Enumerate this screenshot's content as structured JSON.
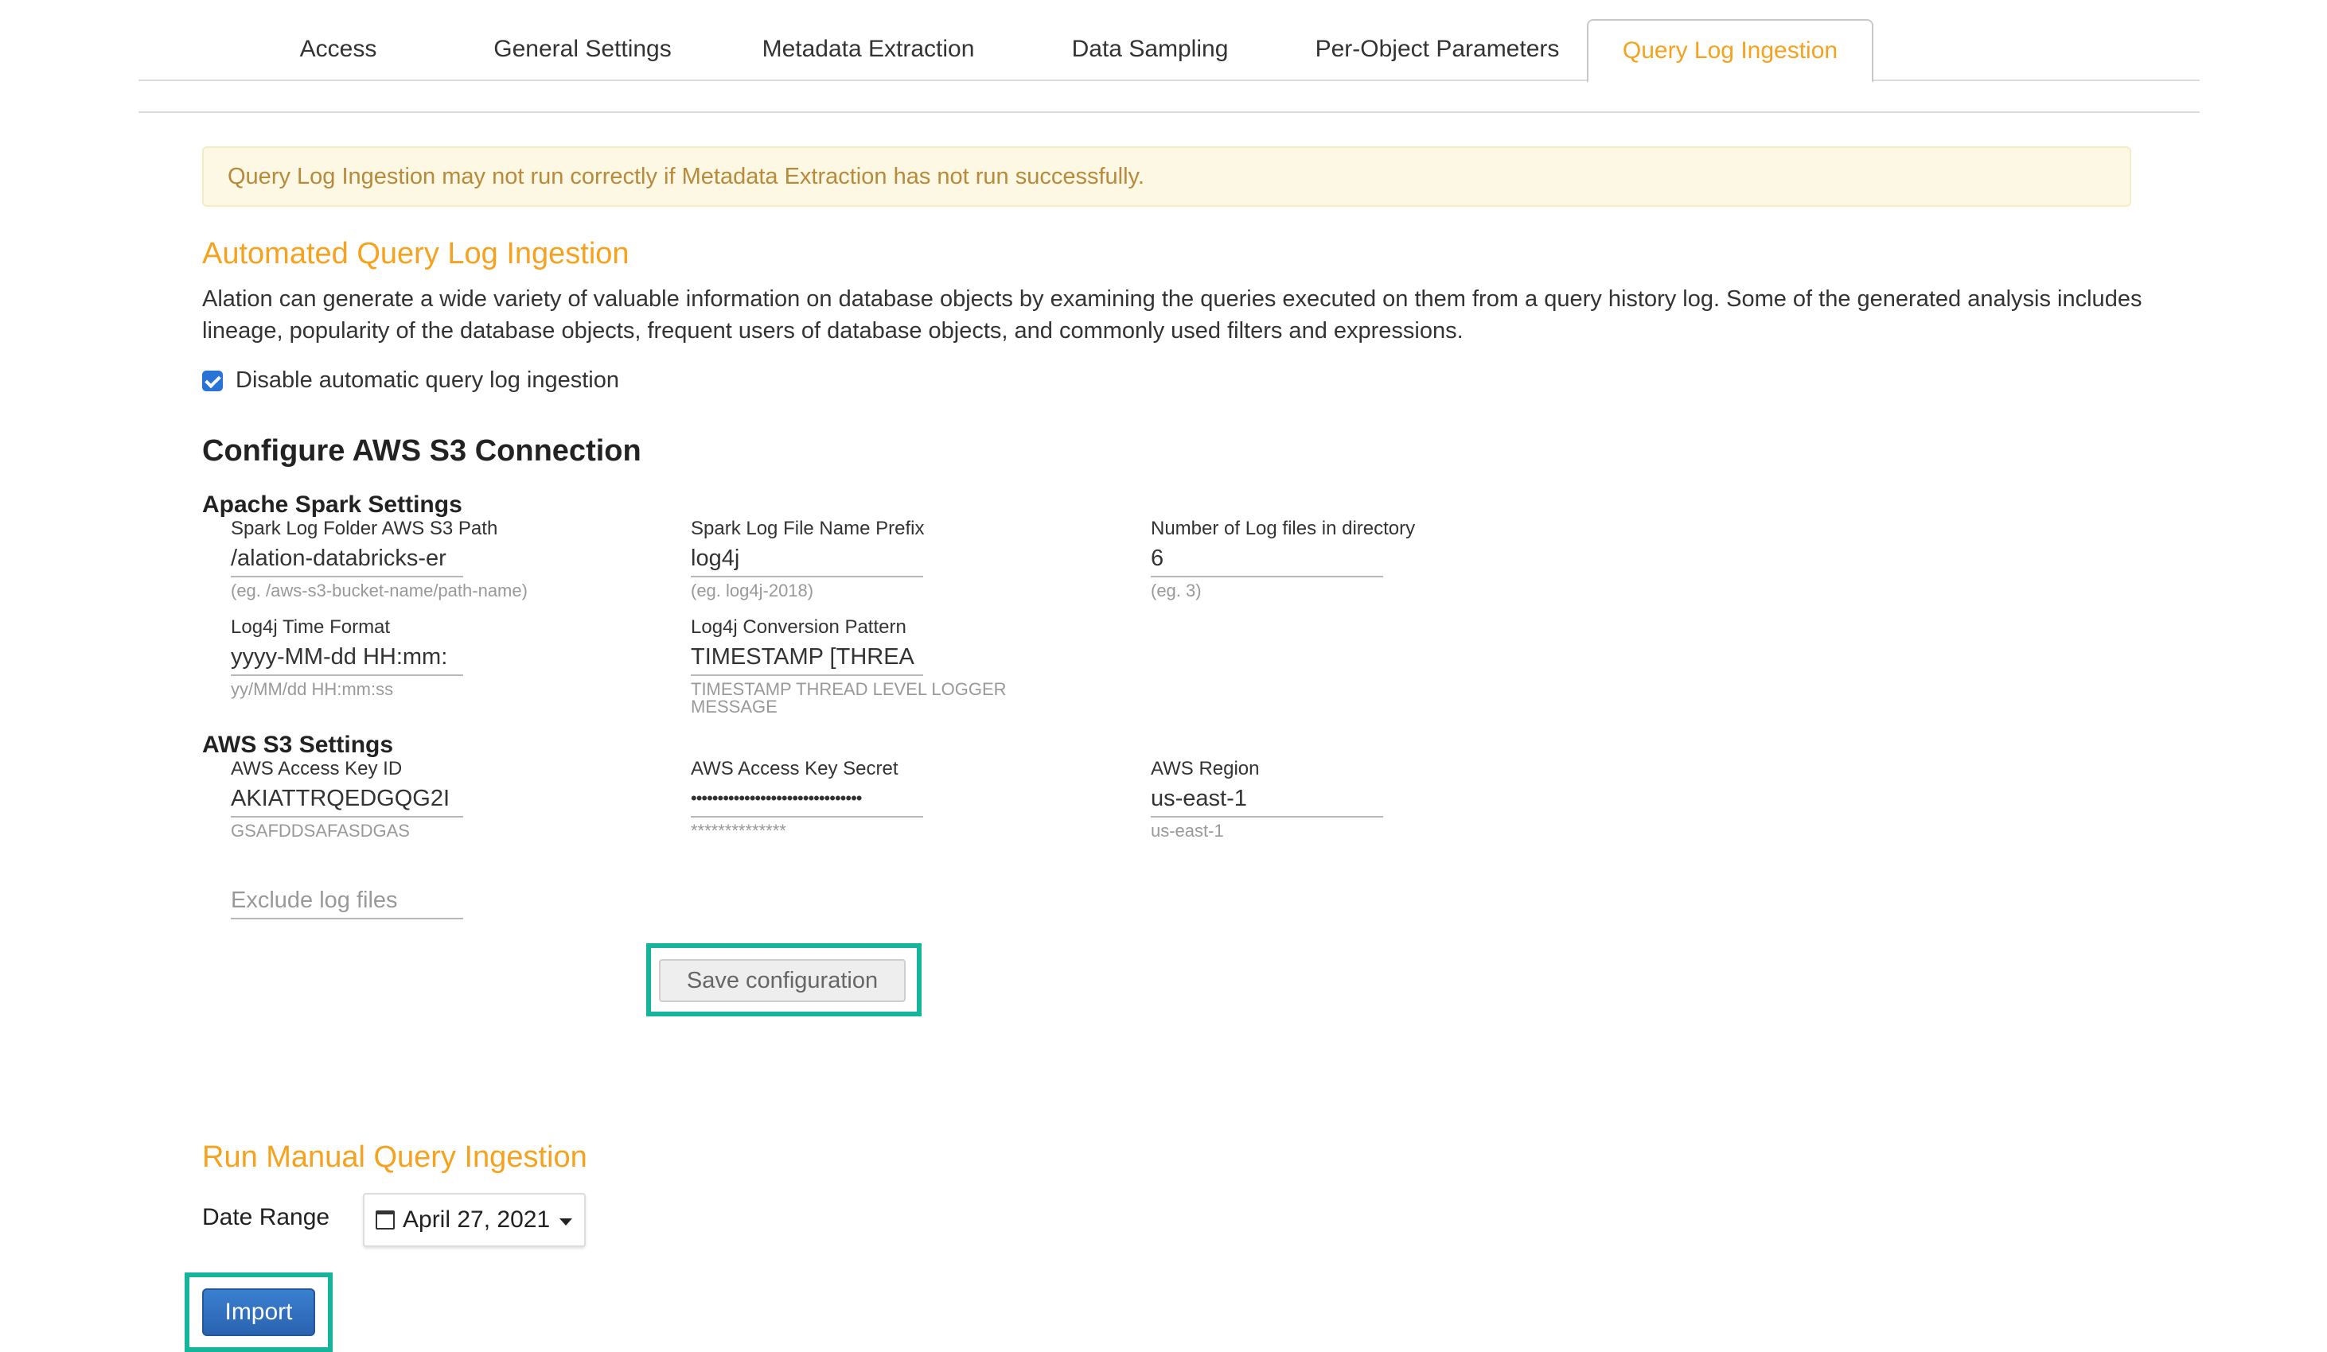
{
  "tabs": [
    "Access",
    "General Settings",
    "Metadata Extraction",
    "Data Sampling",
    "Per-Object Parameters",
    "Query Log Ingestion"
  ],
  "alert": "Query Log Ingestion may not run correctly if Metadata Extraction has not run successfully.",
  "automated": {
    "title": "Automated Query Log Ingestion",
    "description": "Alation can generate a wide variety of valuable information on database objects by examining the queries executed on them from a query history log. Some of the generated analysis includes lineage, popularity of the database objects, frequent users of database objects, and commonly used filters and expressions.",
    "checkbox_label": "Disable automatic query log ingestion",
    "checkbox_checked": true
  },
  "configure": {
    "title": "Configure AWS S3 Connection",
    "spark_title": "Apache Spark Settings",
    "s3_title": "AWS S3 Settings",
    "spark_fields": [
      {
        "label": "Spark Log Folder AWS S3 Path",
        "value": "/alation-databricks-er",
        "hint": "(eg. /aws-s3-bucket-name/path-name)"
      },
      {
        "label": "Spark Log File Name Prefix",
        "value": "log4j",
        "hint": "(eg. log4j-2018)"
      },
      {
        "label": "Number of Log files in directory",
        "value": "6",
        "hint": "(eg. 3)"
      },
      {
        "label": "Log4j Time Format",
        "value": "yyyy-MM-dd HH:mm:",
        "hint": "yy/MM/dd HH:mm:ss"
      },
      {
        "label": "Log4j Conversion Pattern",
        "value": "TIMESTAMP [THREA",
        "hint": "TIMESTAMP THREAD LEVEL LOGGER MESSAGE"
      }
    ],
    "s3_fields": [
      {
        "label": "AWS Access Key ID",
        "value": "AKIATTRQEDGQG2I",
        "hint": "GSAFDDSAFASDGAS"
      },
      {
        "label": "AWS Access Key Secret",
        "value": "••••••••••••••••••••••••••••••••",
        "hint": "**************"
      },
      {
        "label": "AWS Region",
        "value": "us-east-1",
        "hint": "us-east-1"
      }
    ],
    "exclude_placeholder": "Exclude log files",
    "save_label": "Save configuration"
  },
  "manual": {
    "title": "Run Manual Query Ingestion",
    "date_label": "Date Range",
    "date_value": "April 27, 2021",
    "import_label": "Import"
  },
  "colors": {
    "accent": "#f7a21e",
    "highlight": "#14b59a",
    "primary": "#2a63b0"
  }
}
